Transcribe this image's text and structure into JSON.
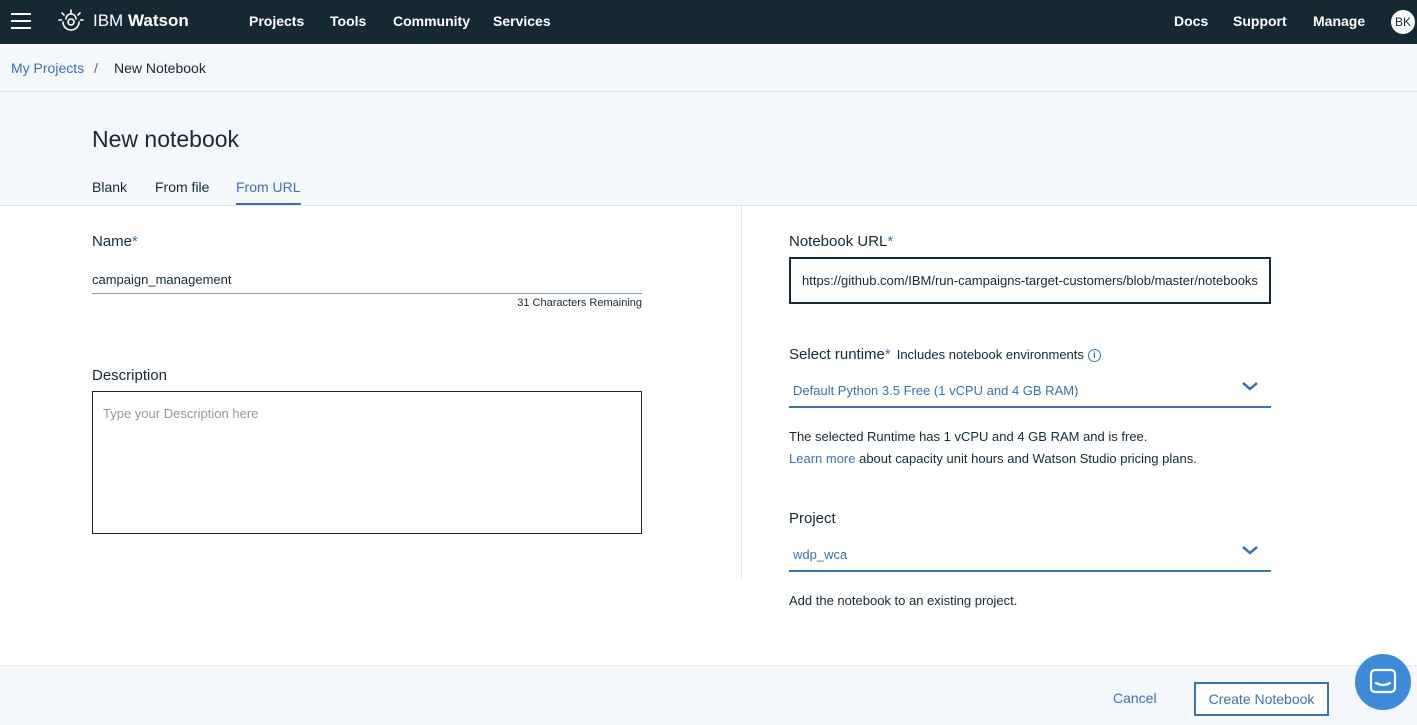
{
  "topbar": {
    "brand_prefix": "IBM ",
    "brand_name": "Watson",
    "nav": [
      "Projects",
      "Tools",
      "Community",
      "Services"
    ],
    "right_nav": [
      "Docs",
      "Support",
      "Manage"
    ],
    "avatar_initials": "BK"
  },
  "breadcrumb": {
    "parent": "My Projects",
    "separator": "/",
    "current": "New Notebook"
  },
  "page": {
    "title": "New notebook",
    "tabs": [
      {
        "label": "Blank",
        "active": false
      },
      {
        "label": "From file",
        "active": false
      },
      {
        "label": "From URL",
        "active": true
      }
    ]
  },
  "form": {
    "name_label": "Name",
    "required_mark": "*",
    "name_value": "campaign_management",
    "chars_remaining": "31 Characters Remaining",
    "description_label": "Description",
    "description_placeholder": "Type your Description here",
    "url_label": "Notebook URL",
    "url_value": "https://github.com/IBM/run-campaigns-target-customers/blob/master/notebooks/campaign_management.ipynb",
    "runtime_label": "Select runtime",
    "runtime_hint": "Includes notebook environments",
    "runtime_value": "Default Python 3.5 Free (1 vCPU and 4 GB RAM)",
    "runtime_help": "The selected Runtime has 1 vCPU and 4 GB RAM and is free.",
    "learn_more": "Learn more",
    "learn_more_rest": " about capacity unit hours and Watson Studio pricing plans.",
    "project_label": "Project",
    "project_value": "wdp_wca",
    "project_help": "Add the notebook to an existing project."
  },
  "footer": {
    "cancel_label": "Cancel",
    "create_label": "Create Notebook"
  },
  "colors": {
    "topbar": "#152935",
    "accent": "#3d70b2",
    "background_light": "#f4f7fb",
    "chat_button": "#3d8ad9"
  },
  "icons": [
    "menu-icon",
    "watson-logo-icon",
    "info-icon",
    "chevron-down-icon",
    "chat-icon"
  ]
}
